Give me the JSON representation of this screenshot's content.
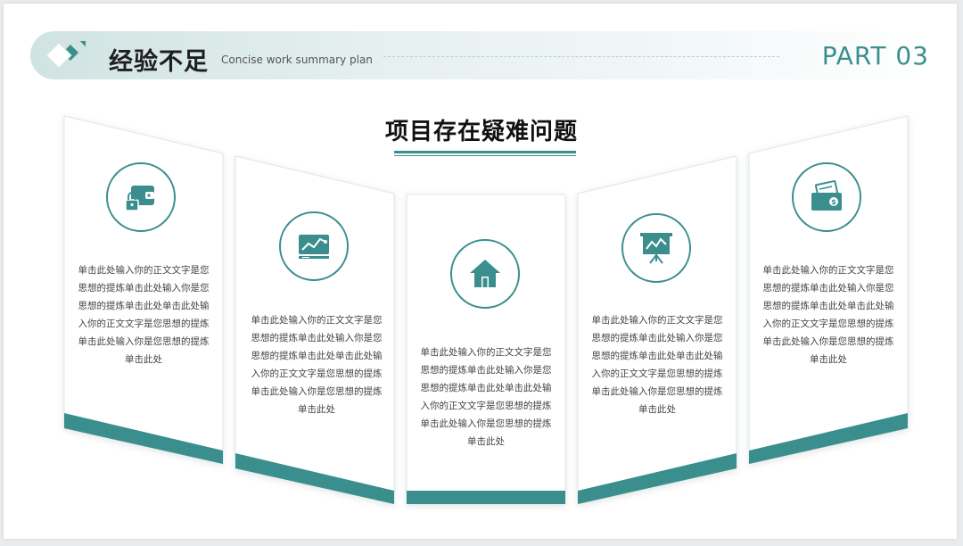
{
  "header": {
    "title": "经验不足",
    "subtitle": "Concise work summary plan",
    "part": "PART 03"
  },
  "section": {
    "heading": "项目存在疑难问题"
  },
  "cards": [
    {
      "icon": "wallet-lock-icon",
      "text": "单击此处输入你的正文文字是您思想的提炼单击此处输入你是您思想的提炼单击此处单击此处输入你的正文文字是您思想的提炼单击此处输入你是您思想的提炼单击此处"
    },
    {
      "icon": "chart-monitor-icon",
      "text": "单击此处输入你的正文文字是您思想的提炼单击此处输入你是您思想的提炼单击此处单击此处输入你的正文文字是您思想的提炼单击此处输入你是您思想的提炼单击此处"
    },
    {
      "icon": "home-icon",
      "text": "单击此处输入你的正文文字是您思想的提炼单击此处输入你是您思想的提炼单击此处单击此处输入你的正文文字是您思想的提炼单击此处输入你是您思想的提炼单击此处"
    },
    {
      "icon": "presentation-chart-icon",
      "text": "单击此处输入你的正文文字是您思想的提炼单击此处输入你是您思想的提炼单击此处单击此处输入你的正文文字是您思想的提炼单击此处输入你是您思想的提炼单击此处"
    },
    {
      "icon": "money-icon",
      "text": "单击此处输入你的正文文字是您思想的提炼单击此处输入你是您思想的提炼单击此处单击此处输入你的正文文字是您思想的提炼单击此处输入你是您思想的提炼单击此处"
    }
  ],
  "colors": {
    "accent": "#3a8f8e",
    "accent_dark": "#2b7574"
  }
}
